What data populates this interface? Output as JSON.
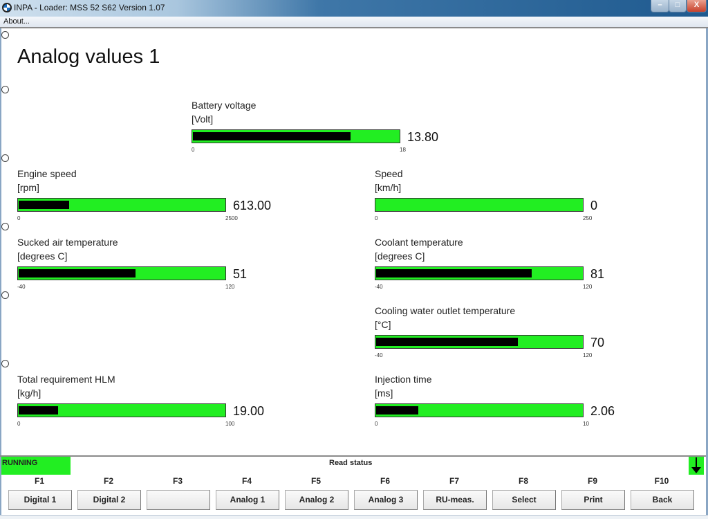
{
  "window": {
    "title": "INPA - Loader:  MSS 52 S62 Version 1.07",
    "controls": {
      "minimize": "–",
      "maximize": "□",
      "close": "X"
    }
  },
  "menu": {
    "items": [
      {
        "label": "About..."
      }
    ]
  },
  "page": {
    "title": "Analog values 1"
  },
  "colors": {
    "bar_bg": "#22ee22",
    "bar_fill": "#000000",
    "status_running": "#22ee22"
  },
  "gauges": [
    {
      "label": "Battery voltage",
      "unit": "[Volt]",
      "value": "13.80",
      "numeric": 13.8,
      "min": "0",
      "max": "18",
      "min_num": 0,
      "max_num": 18
    },
    {
      "label": "Engine speed",
      "unit": "[rpm]",
      "value": "613.00",
      "numeric": 613,
      "min": "0",
      "max": "2500",
      "min_num": 0,
      "max_num": 2500
    },
    {
      "label": "Speed",
      "unit": "[km/h]",
      "value": "0",
      "numeric": 0,
      "min": "0",
      "max": "250",
      "min_num": 0,
      "max_num": 250
    },
    {
      "label": "Sucked air temperature",
      "unit": "[degrees C]",
      "value": "51",
      "numeric": 51,
      "min": "-40",
      "max": "120",
      "min_num": -40,
      "max_num": 120
    },
    {
      "label": "Coolant temperature",
      "unit": "[degrees C]",
      "value": "81",
      "numeric": 81,
      "min": "-40",
      "max": "120",
      "min_num": -40,
      "max_num": 120
    },
    {
      "label": "Cooling water outlet temperature",
      "unit": "[°C]",
      "value": "70",
      "numeric": 70,
      "min": "-40",
      "max": "120",
      "min_num": -40,
      "max_num": 120
    },
    {
      "label": "Total requirement HLM",
      "unit": "[kg/h]",
      "value": "19.00",
      "numeric": 19,
      "min": "0",
      "max": "100",
      "min_num": 0,
      "max_num": 100
    },
    {
      "label": "Injection time",
      "unit": "[ms]",
      "value": "2.06",
      "numeric": 2.06,
      "min": "0",
      "max": "10",
      "min_num": 0,
      "max_num": 10
    }
  ],
  "status": {
    "state": "RUNNING",
    "message": "Read status",
    "scroll_icon": "arrow-down-icon"
  },
  "function_keys": [
    {
      "key": "F1",
      "label": "Digital 1"
    },
    {
      "key": "F2",
      "label": "Digital 2"
    },
    {
      "key": "F3",
      "label": ""
    },
    {
      "key": "F4",
      "label": "Analog 1"
    },
    {
      "key": "F5",
      "label": "Analog 2"
    },
    {
      "key": "F6",
      "label": "Analog 3"
    },
    {
      "key": "F7",
      "label": "RU-meas."
    },
    {
      "key": "F8",
      "label": "Select"
    },
    {
      "key": "F9",
      "label": "Print"
    },
    {
      "key": "F10",
      "label": "Back"
    }
  ]
}
